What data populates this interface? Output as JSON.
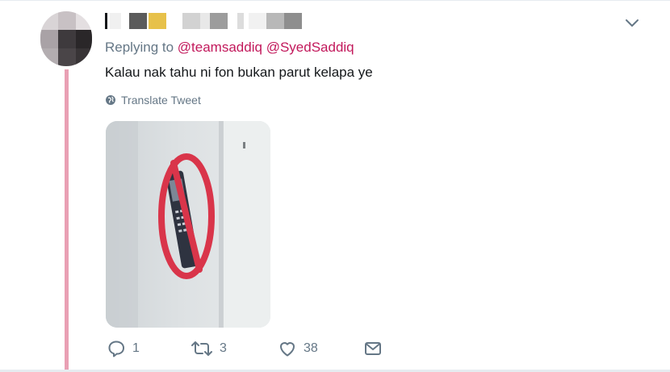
{
  "tweet": {
    "reply_prefix": "Replying to",
    "mentions": [
      "@teamsaddiq",
      "@SyedSaddiq"
    ],
    "text": "Kalau nak tahu ni fon bukan parut kelapa ye",
    "translate_label": "Translate Tweet",
    "media": {
      "icon": "no-phone-sign-icon"
    },
    "actions": {
      "reply_count": "1",
      "retweet_count": "3",
      "like_count": "38"
    }
  },
  "icons": {
    "more": "chevron-down-icon",
    "reply": "reply-icon",
    "retweet": "retweet-icon",
    "like": "heart-icon",
    "dm": "envelope-icon",
    "translate": "globe-icon"
  },
  "colors": {
    "mention": "#c2185b",
    "muted": "#657786",
    "thread_line": "#e9a0b4",
    "sign_red": "#d9354a"
  }
}
